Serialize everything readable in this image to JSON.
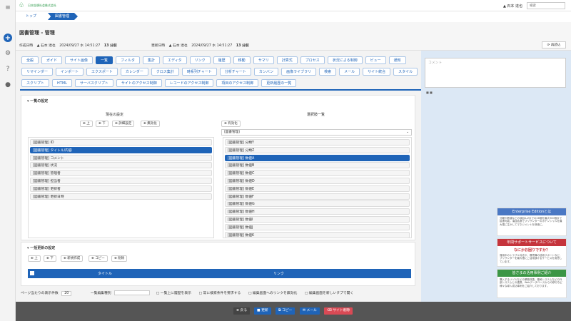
{
  "company": "日本仮想社会株式会社",
  "user": "石本 達也",
  "search_placeholder": "検索",
  "breadcrumb": [
    "トップ",
    "図書管理"
  ],
  "page": {
    "title": "図書管理 - 管理",
    "created_label": "作成日時",
    "created_by": "石本 達也",
    "created_at": "2024/09/27 水 14:51:27",
    "created_ago": "13 分前",
    "updated_label": "更新日時",
    "updated_by": "石本 達也",
    "updated_at": "2024/09/27 水 14:51:27",
    "updated_ago": "13 分前",
    "reload": "再読込"
  },
  "tabs": {
    "row1": [
      "全般",
      "ガイド",
      "サイト画像",
      "一覧",
      "フィルタ",
      "集計",
      "エディタ",
      "リンク",
      "履歴",
      "移動",
      "サマリ",
      "計算式",
      "プロセス",
      "状況による制御",
      "ビュー",
      "通知"
    ],
    "row2": [
      "リマインダー",
      "インポート",
      "エクスポート",
      "カレンダー",
      "クロス集計",
      "時系列チャート",
      "分析チャート",
      "カンバン",
      "画像ライブラリ",
      "検索",
      "メール",
      "サイト統合",
      "スタイル"
    ],
    "row3": [
      "スクリプト",
      "HTML",
      "サーバスクリプト",
      "サイトのアクセス制御",
      "レコードのアクセス制御",
      "項目のアクセス制御",
      "更新履歴の一覧"
    ],
    "active": "一覧"
  },
  "list_settings": {
    "title": "一覧の設定",
    "current_label": "現在の設定",
    "available_label": "選択肢一覧",
    "buttons": [
      "上",
      "下",
      "詳細設定",
      "無効化"
    ],
    "enable_button": "有効化",
    "table_select": "[図書管理]",
    "current_items": [
      "[図書管理] ID",
      "[図書管理] タイトル/内容",
      "[図書管理] コメント",
      "[図書管理] 状況",
      "[図書管理] 管理者",
      "[図書管理] 担当者",
      "[図書管理] 更新者",
      "[図書管理] 更新日時"
    ],
    "available_items": [
      "[図書管理] 分類Y",
      "[図書管理] 分類Z",
      "[図書管理] 数値A",
      "[図書管理] 数値B",
      "[図書管理] 数値C",
      "[図書管理] 数値D",
      "[図書管理] 数値E",
      "[図書管理] 数値F",
      "[図書管理] 数値G",
      "[図書管理] 数値H",
      "[図書管理] 数値I",
      "[図書管理] 数値J",
      "[図書管理] 数値K"
    ]
  },
  "bulk_settings": {
    "title": "一括更新の設定",
    "buttons": [
      "上",
      "下",
      "新規作成",
      "コピー",
      "削除"
    ],
    "columns": [
      "タイトル",
      "リンク"
    ]
  },
  "bottom_settings": {
    "page_size_label": "ページ当たりの表示件数",
    "page_size": "20",
    "edit_type_label": "一覧編集種別",
    "options": [
      "一覧上に履歴を表示",
      "常に検索条件を要求する",
      "編集画面へのリンクを無効化",
      "編集画面を新しいタブで開く"
    ]
  },
  "footer": [
    "戻る",
    "更新",
    "コピー",
    "メール",
    "サイト削除"
  ],
  "comment_placeholder": "コメント",
  "ads": [
    {
      "title": "Enterprise Editionとは",
      "body": "分離や数値などの項目A-Zまでの26個を最大900個まで拡張可能。項目拡張でプリザンターのポテンシャルを最大限に生かしてマネジメントを快適に。"
    },
    {
      "title": "年間サポートサービスについて",
      "subtitle": "なにかお困りですか？",
      "body": "運用中のトラブル対応や、環境構の技術サポートなど、プリザンターを最大限にご活用頂けるサービスを用意しています。"
    },
    {
      "title": "皆さまの活用事例ご紹介",
      "body": "購入するリゾルなどの業務改善、基幹システムなどの外部システムとの連携、Webデータベースからの移行など様々な導入成功事例をご紹介しております。"
    }
  ]
}
